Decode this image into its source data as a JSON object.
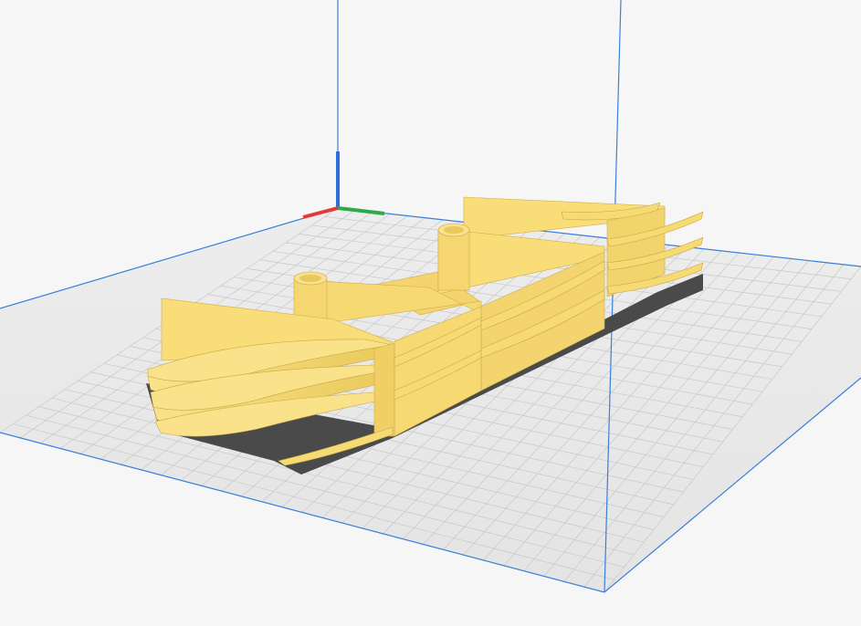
{
  "viewport": {
    "background_color": "#f6f6f6",
    "grid_color": "#c8c8c8",
    "plate_color": "#ececec",
    "build_volume_color": "#3a7fd9",
    "model_color": "#f8dd78",
    "model_shade_color": "#e8c85c",
    "model_dark_color": "#d4b04a",
    "shadow_color": "#4a4a4a",
    "axis_x_color": "#e53935",
    "axis_y_color": "#2ea84a",
    "axis_z_color": "#2d6fd6"
  },
  "icons": {
    "axis_gizmo": "axis-gizmo-icon"
  }
}
